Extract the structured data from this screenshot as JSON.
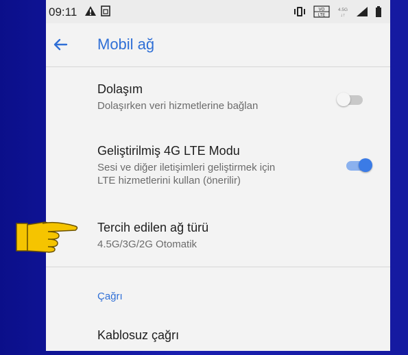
{
  "status_bar": {
    "time": "09:11",
    "left_icons": [
      "warning-icon",
      "sim-icon"
    ],
    "right_icons": [
      "vibrate-icon",
      "volte-icon",
      "network-4-5g-icon",
      "signal-icon",
      "battery-icon"
    ],
    "volte_label": "VO\nLTE",
    "network_label": "4.5G"
  },
  "app_bar": {
    "title": "Mobil ağ",
    "back_icon": "back-arrow-icon"
  },
  "settings": [
    {
      "title": "Dolaşım",
      "subtitle": "Dolaşırken veri hizmetlerine bağlan",
      "toggle": false
    },
    {
      "title": "Geliştirilmiş 4G LTE Modu",
      "subtitle_line1": "Sesi ve diğer iletişimleri geliştirmek için",
      "subtitle_line2": "LTE hizmetlerini kullan (önerilir)",
      "toggle": true
    },
    {
      "title": "Tercih edilen ağ türü",
      "subtitle": "4.5G/3G/2G Otomatik"
    }
  ],
  "section_header": "Çağrı",
  "call_items": [
    {
      "title": "Kablosuz çağrı"
    }
  ],
  "colors": {
    "accent": "#2f6fd6",
    "toggle_on_track": "#8bb1ee",
    "toggle_on_knob": "#3b7be6",
    "toggle_off_track": "#c8c8c8",
    "toggle_off_knob": "#f5f5f5",
    "pointer_hand": "#f5c400"
  },
  "annotation_icon": "pointing-hand-icon"
}
